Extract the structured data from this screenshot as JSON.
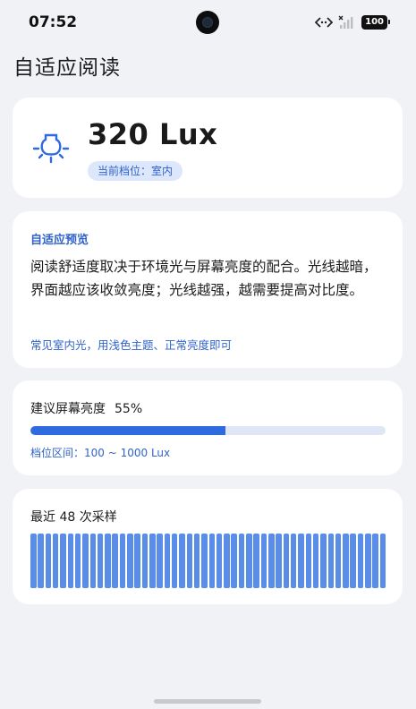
{
  "status_bar": {
    "time": "07:52",
    "battery": "100"
  },
  "page": {
    "title": "自适应阅读"
  },
  "lux_card": {
    "icon": "light-bulb-icon",
    "value": "320 Lux",
    "level_badge": "当前档位：室内"
  },
  "preview_card": {
    "heading": "自适应预览",
    "body": "阅读舒适度取决于环境光与屏幕亮度的配合。光线越暗，界面越应该收敛亮度；光线越强，越需要提高对比度。",
    "note": "常见室内光，用浅色主题、正常亮度即可"
  },
  "brightness_card": {
    "label": "建议屏幕亮度",
    "value": "55%",
    "progress": 0.55,
    "range": "档位区间：100 ~ 1000 Lux"
  },
  "samples_card": {
    "label": "最近 48 次采样",
    "sample_count": 48
  },
  "colors": {
    "accent": "#2f63c9",
    "progress_fill": "#2f6ade",
    "progress_track": "#dfe7f7",
    "sample_bar": "#5a8de8",
    "card_bg": "#ffffff",
    "page_bg": "#f1f2f5"
  }
}
